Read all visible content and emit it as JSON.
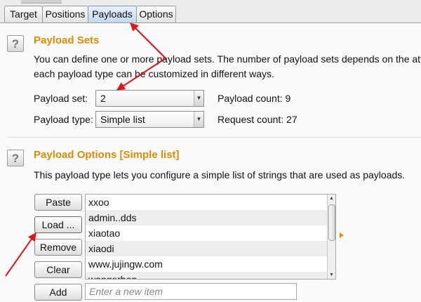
{
  "tabs": [
    {
      "label": "Target",
      "active": false
    },
    {
      "label": "Positions",
      "active": false
    },
    {
      "label": "Payloads",
      "active": true
    },
    {
      "label": "Options",
      "active": false
    }
  ],
  "payload_sets": {
    "help": "?",
    "title": "Payload Sets",
    "desc_line1": "You can define one or more payload sets. The number of payload sets depends on the atta",
    "desc_line2": "each payload type can be customized in different ways.",
    "set_label": "Payload set:",
    "set_value": "2",
    "type_label": "Payload type:",
    "type_value": "Simple list",
    "payload_count": "Payload count: 9",
    "request_count": "Request count: 27"
  },
  "payload_options": {
    "help": "?",
    "title": "Payload Options [Simple list]",
    "desc": "This payload type lets you configure a simple list of strings that are used as payloads.",
    "buttons": {
      "paste": "Paste",
      "load": "Load ...",
      "remove": "Remove",
      "clear": "Clear",
      "add": "Add"
    },
    "items": [
      "xxoo",
      "admin..dds",
      "xiaotao",
      "xiaodi",
      "www.jujingw.com",
      "wangerban"
    ],
    "add_placeholder": "Enter a new item"
  },
  "colors": {
    "section_title": "#e58a00",
    "annotation_arrow": "#e0141b",
    "active_tab": "#c3d8ee"
  }
}
